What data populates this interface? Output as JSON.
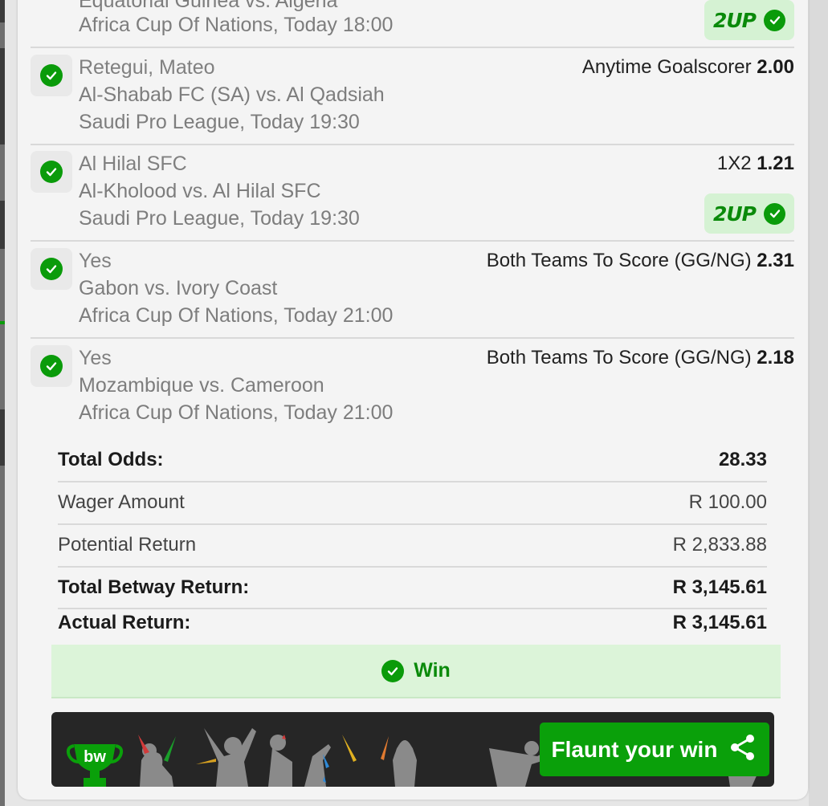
{
  "colors": {
    "accent_green": "#0a9b0a",
    "win_bg": "#dcf4d9",
    "banner_bg": "#262626",
    "flaunt_button": "#0aa00a"
  },
  "legs": [
    {
      "selection": "Equatorial Guinea vs. Algeria",
      "teams": "",
      "competition": "Africa Cup Of Nations, Today 18:00",
      "market": "",
      "odds": "",
      "badge": "2UP",
      "partial": true
    },
    {
      "selection": "Retegui, Mateo",
      "teams": "Al-Shabab FC (SA) vs. Al Qadsiah",
      "competition": "Saudi Pro League, Today 19:30",
      "market": "Anytime Goalscorer",
      "odds": "2.00",
      "badge": ""
    },
    {
      "selection": "Al Hilal SFC",
      "teams": "Al-Kholood vs. Al Hilal SFC",
      "competition": "Saudi Pro League, Today 19:30",
      "market": "1X2",
      "odds": "1.21",
      "badge": "2UP"
    },
    {
      "selection": "Yes",
      "teams": "Gabon vs. Ivory Coast",
      "competition": "Africa Cup Of Nations, Today 21:00",
      "market": "Both Teams To Score (GG/NG)",
      "odds": "2.31",
      "badge": ""
    },
    {
      "selection": "Yes",
      "teams": "Mozambique vs. Cameroon",
      "competition": "Africa Cup Of Nations, Today 21:00",
      "market": "Both Teams To Score (GG/NG)",
      "odds": "2.18",
      "badge": ""
    }
  ],
  "summary": {
    "total_odds_label": "Total Odds:",
    "total_odds_value": "28.33",
    "wager_label": "Wager Amount",
    "wager_value": "R 100.00",
    "potential_label": "Potential Return",
    "potential_value": "R 2,833.88",
    "betway_return_label": "Total Betway Return:",
    "betway_return_value": "R 3,145.61",
    "actual_return_label": "Actual Return:",
    "actual_return_value": "R 3,145.61"
  },
  "result": {
    "status_label": "Win"
  },
  "banner": {
    "logo_text": "bw",
    "flaunt_label": "Flaunt your win"
  }
}
